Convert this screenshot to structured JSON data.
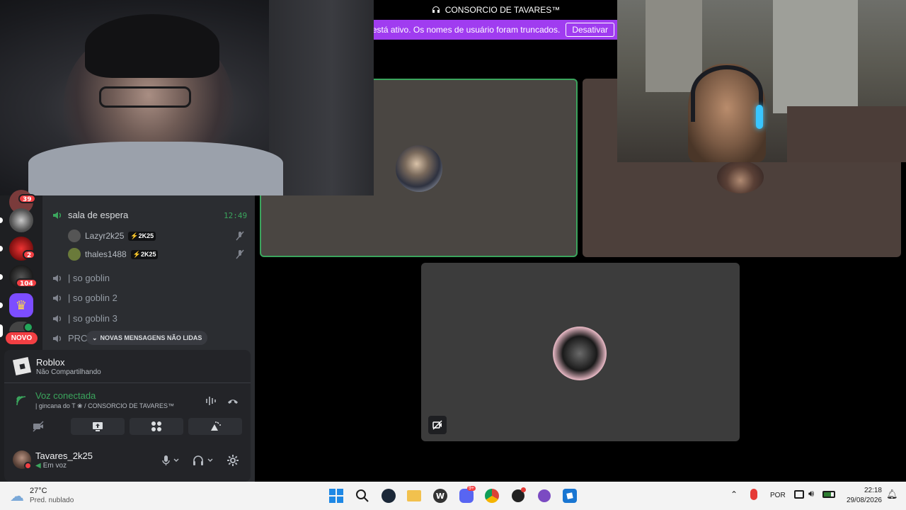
{
  "header": {
    "server_name": "CONSORCIO DE TAVARES™",
    "banner_text": "er está ativo. Os nomes de usuário foram truncados.",
    "banner_button": "Desativar"
  },
  "rail": {
    "servers": [
      {
        "badge": "39"
      },
      {
        "badge": ""
      },
      {
        "badge": "2"
      },
      {
        "badge": "104"
      },
      {
        "badge": ""
      },
      {
        "badge": ""
      }
    ],
    "new_button": "NOVO"
  },
  "channels": {
    "waiting_room": {
      "name": "sala de espera",
      "timer": "12:49"
    },
    "users": [
      {
        "name": "Lazyr2k25",
        "tag": "2K25"
      },
      {
        "name": "thales1488",
        "tag": "2K25"
      }
    ],
    "voice_channels": [
      "| so goblin",
      "| so goblin 2",
      "| so goblin 3",
      "PRO"
    ],
    "unread_pill": "NOVAS MENSAGENS NÃO LIDAS"
  },
  "activity": {
    "title": "Roblox",
    "subtitle": "Não Compartilhando"
  },
  "voice": {
    "status": "Voz conectada",
    "location": "| gincana do T ❀ / CONSORCIO DE TAVARES™"
  },
  "user": {
    "name": "Tavares_2k25",
    "status": "Em voz"
  },
  "taskbar": {
    "weather_temp": "27°C",
    "weather_desc": "Pred. nublado",
    "language": "POR",
    "time": "22:18",
    "date": "29/08/2026",
    "discord_badge": "9+"
  },
  "colors": {
    "accent": "#a03cf0",
    "speaking_green": "#3ba55d",
    "danger": "#f23f43"
  }
}
